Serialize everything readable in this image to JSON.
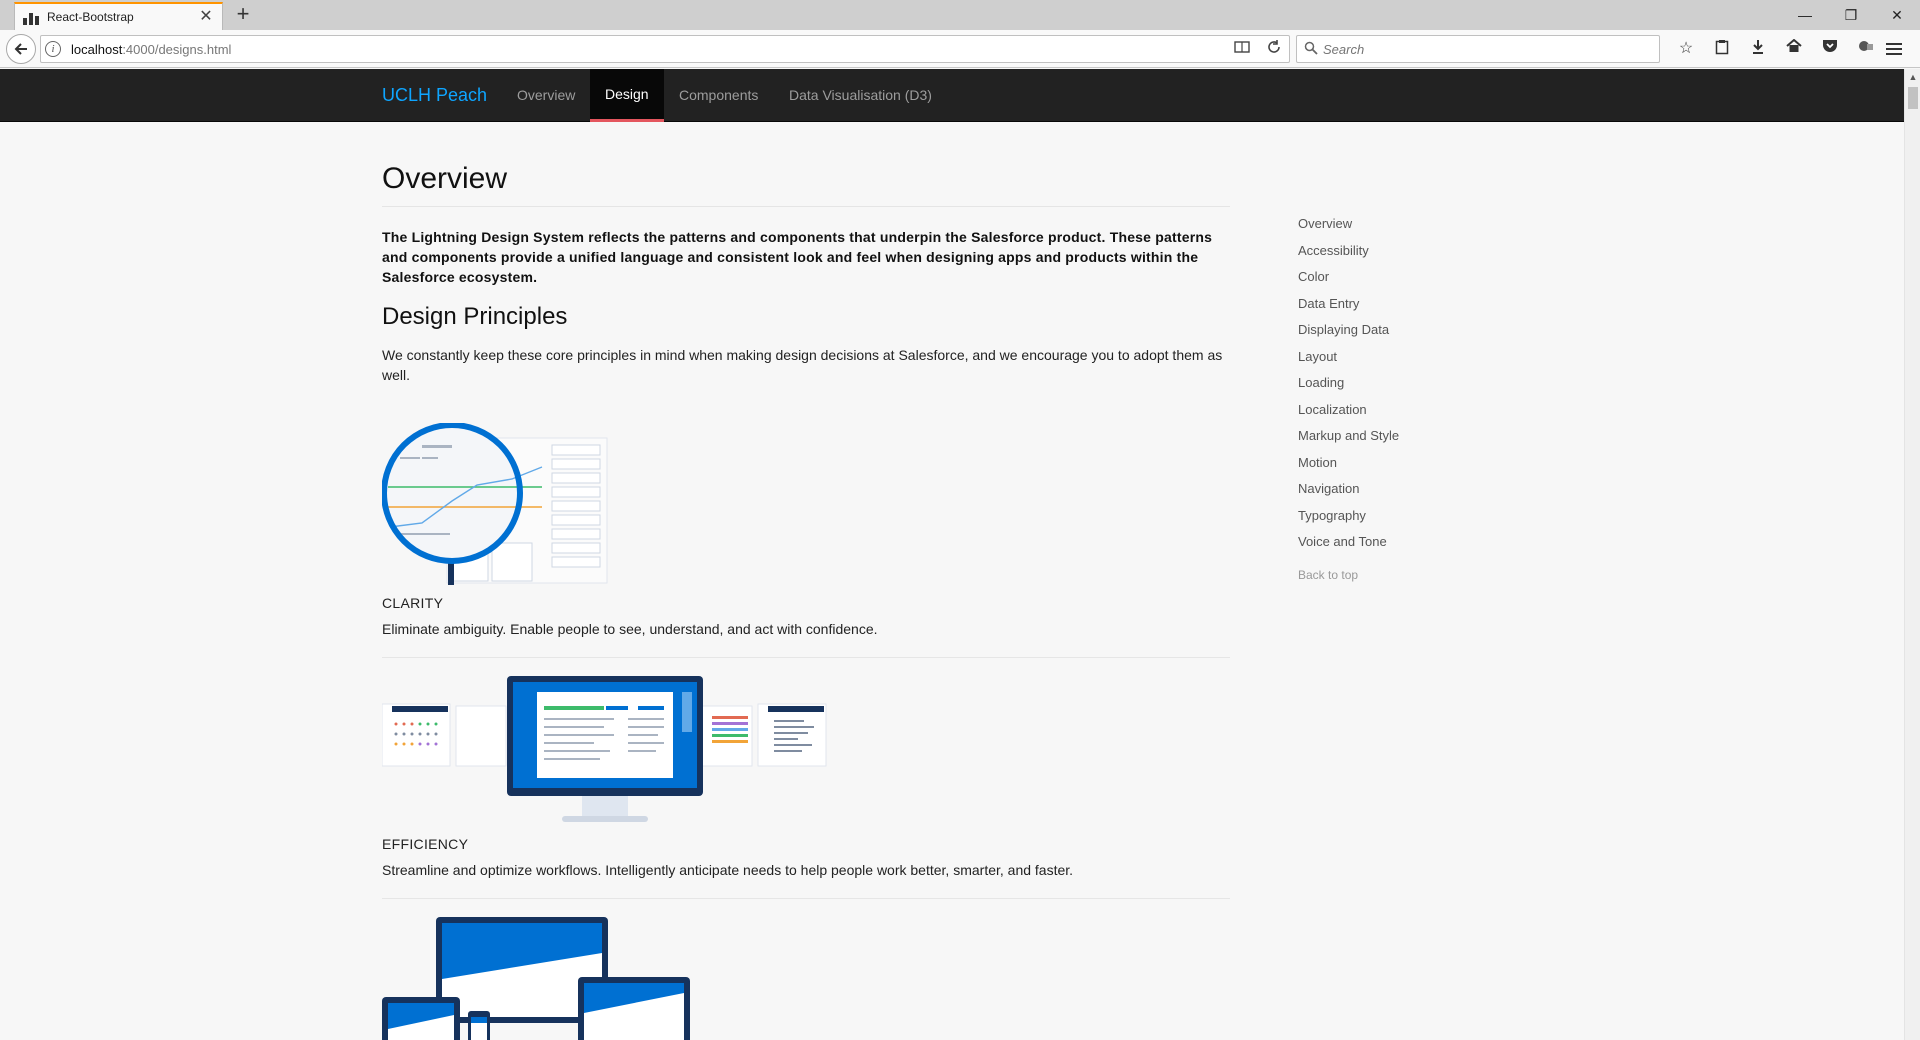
{
  "browser": {
    "tab_title": "React-Bootstrap",
    "tab_close": "✕",
    "new_tab": "+",
    "url_host": "localhost",
    "url_path": ":4000/designs.html",
    "search_placeholder": "Search",
    "win_minimize": "—",
    "win_restore": "❐",
    "win_close": "✕"
  },
  "site": {
    "brand": "UCLH Peach",
    "nav": [
      {
        "label": "Overview"
      },
      {
        "label": "Design"
      },
      {
        "label": "Components"
      },
      {
        "label": "Data Visualisation (D3)"
      }
    ],
    "active_nav": "Design"
  },
  "content": {
    "title": "Overview",
    "lead": "The Lightning Design System reflects the patterns and components that underpin the Salesforce product. These patterns and components provide a unified language and consistent look and feel when designing apps and products within the Salesforce ecosystem.",
    "principles_heading": "Design Principles",
    "principles_intro": "We constantly keep these core principles in mind when making design decisions at Salesforce, and we encourage you to adopt them as well.",
    "principles": [
      {
        "title": "CLARITY",
        "desc": "Eliminate ambiguity. Enable people to see, understand, and act with confidence."
      },
      {
        "title": "EFFICIENCY",
        "desc": "Streamline and optimize workflows. Intelligently anticipate needs to help people work better, smarter, and faster."
      }
    ]
  },
  "sidebar": {
    "items": [
      {
        "label": "Overview"
      },
      {
        "label": "Accessibility"
      },
      {
        "label": "Color"
      },
      {
        "label": "Data Entry"
      },
      {
        "label": "Displaying Data"
      },
      {
        "label": "Layout"
      },
      {
        "label": "Loading"
      },
      {
        "label": "Localization"
      },
      {
        "label": "Markup and Style"
      },
      {
        "label": "Motion"
      },
      {
        "label": "Navigation"
      },
      {
        "label": "Typography"
      },
      {
        "label": "Voice and Tone"
      }
    ],
    "back_to_top": "Back to top"
  },
  "colors": {
    "brand": "#0ea5ff",
    "navbar_bg": "#222222",
    "active_underline": "#e4565e",
    "illustration_blue": "#0070d2",
    "illustration_navy": "#16325c"
  }
}
